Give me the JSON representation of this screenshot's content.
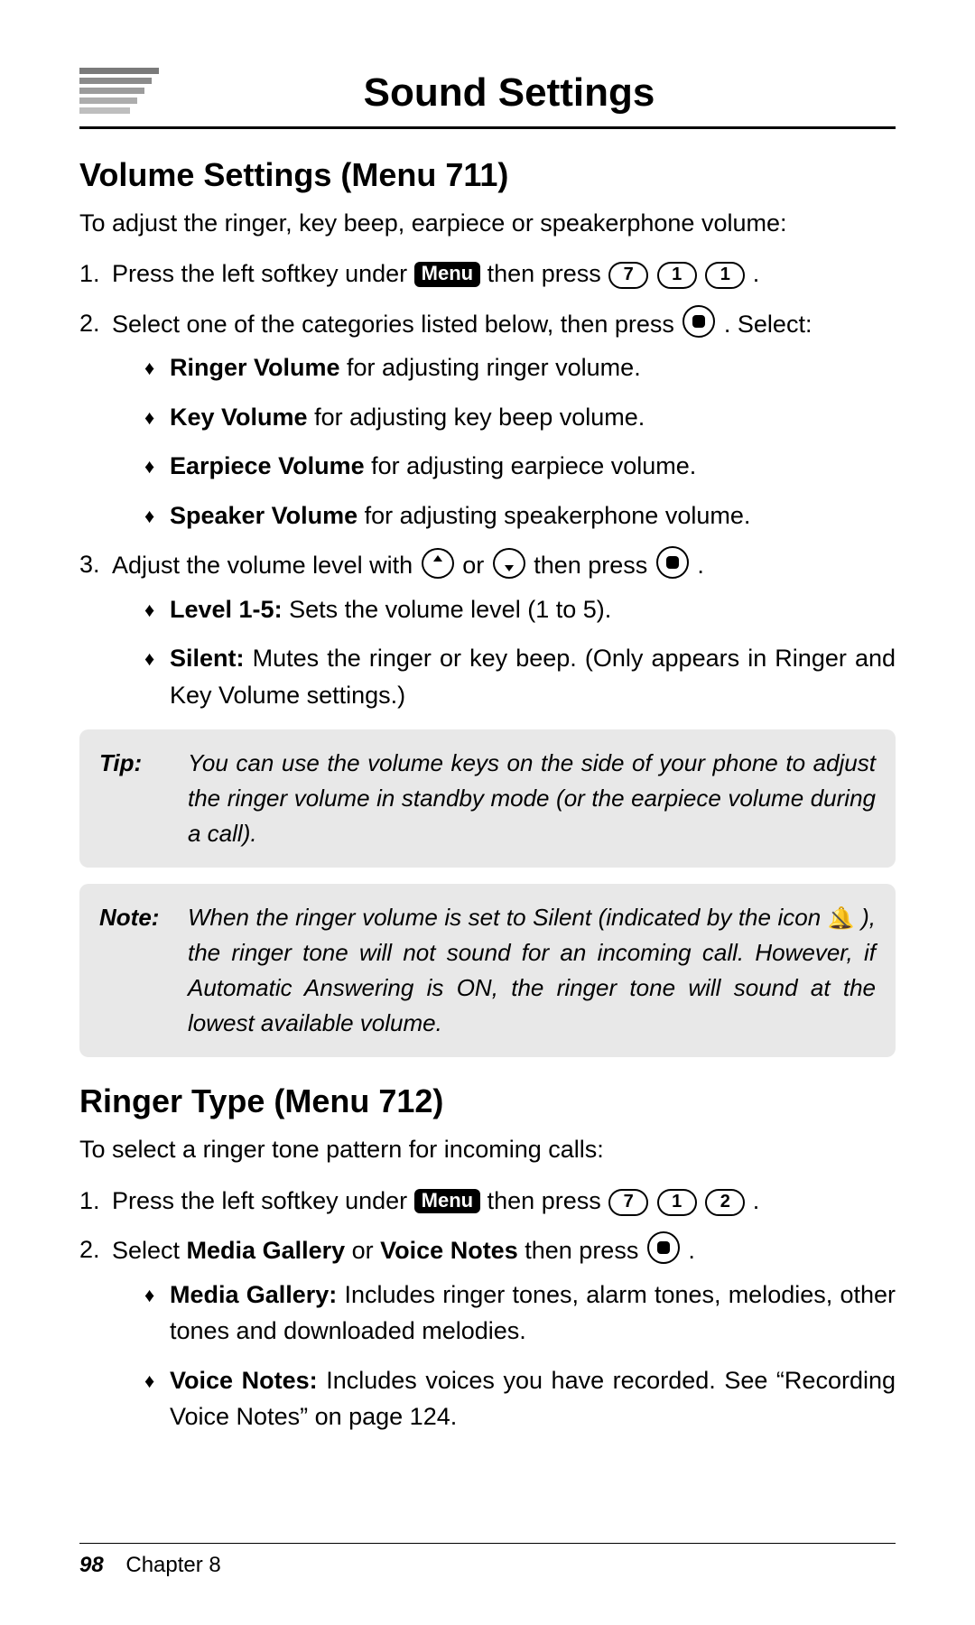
{
  "chapter_title": "Sound Settings",
  "section_a": {
    "heading": "Volume Settings (Menu 711)",
    "intro": "To adjust the ringer, key beep, earpiece or speakerphone volume:",
    "step1_a": "Press the left softkey under ",
    "menu_label": "Menu",
    "step1_b": " then press ",
    "keys1": [
      "7",
      "1",
      "1"
    ],
    "step1_c": ".",
    "step2_a": "Select one of the categories listed below, then press ",
    "step2_b": ". Select:",
    "bullets1": [
      {
        "bold": "Ringer Volume",
        "rest": " for adjusting ringer volume."
      },
      {
        "bold": "Key Volume",
        "rest": " for adjusting key beep volume."
      },
      {
        "bold": "Earpiece Volume",
        "rest": " for adjusting earpiece volume."
      },
      {
        "bold": "Speaker Volume",
        "rest": " for adjusting speakerphone volume."
      }
    ],
    "step3_a": "Adjust the volume level with ",
    "step3_or": " or ",
    "step3_b": " then press ",
    "step3_c": ".",
    "bullets2": [
      {
        "bold": "Level 1-5:",
        "rest": " Sets the volume level (1 to 5)."
      },
      {
        "bold": "Silent:",
        "rest": " Mutes the ringer or key beep. (Only appears in Ringer and Key Volume settings.)"
      }
    ],
    "tip_label": "Tip:",
    "tip_body": "You can use the volume keys on the side of your phone to adjust the ringer volume in standby mode (or the earpiece volume during a call).",
    "note_label": "Note:",
    "note_body_a": "When the ringer volume is set to Silent (indicated by the icon ",
    "note_body_b": " ), the ringer tone will not sound for an incoming call. However, if Automatic Answering is ON, the ringer tone will sound at the lowest available volume."
  },
  "section_b": {
    "heading": "Ringer Type (Menu 712)",
    "intro": "To select a ringer tone pattern for incoming calls:",
    "step1_a": "Press the left softkey under ",
    "step1_b": " then press ",
    "keys1": [
      "7",
      "1",
      "2"
    ],
    "step1_c": ".",
    "step2_a": "Select ",
    "step2_mg": "Media Gallery",
    "step2_or": " or ",
    "step2_vn": "Voice Notes",
    "step2_b": " then press ",
    "step2_c": ".",
    "bullets": [
      {
        "bold": "Media Gallery:",
        "rest": " Includes ringer tones, alarm tones, melodies, other tones and downloaded melodies."
      },
      {
        "bold": "Voice Notes:",
        "rest": " Includes voices you have recorded. See “Recording Voice Notes” on page 124."
      }
    ]
  },
  "footer": {
    "page": "98",
    "chapter": "Chapter 8"
  }
}
